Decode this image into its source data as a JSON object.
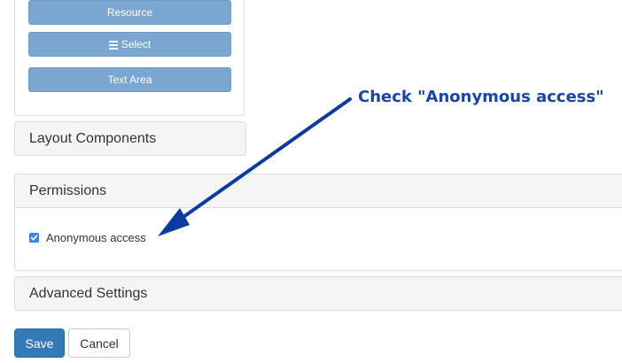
{
  "palette": {
    "buttons": [
      {
        "label": "Resource",
        "icon": ""
      },
      {
        "label": "Select",
        "icon": "list-icon"
      },
      {
        "label": "Text Area",
        "icon": ""
      }
    ]
  },
  "panels": {
    "layout_components": "Layout Components",
    "permissions": {
      "title": "Permissions",
      "anonymous_access_label": "Anonymous access",
      "anonymous_access_checked": true
    },
    "advanced_settings": "Advanced Settings"
  },
  "actions": {
    "save": "Save",
    "cancel": "Cancel"
  },
  "annotation": {
    "text": "Check \"Anonymous access\"",
    "color": "#1747a6"
  },
  "colors": {
    "primary": "#337ab7",
    "palette_button": "#7ba6d2",
    "checkbox": "#3b8cf0"
  }
}
